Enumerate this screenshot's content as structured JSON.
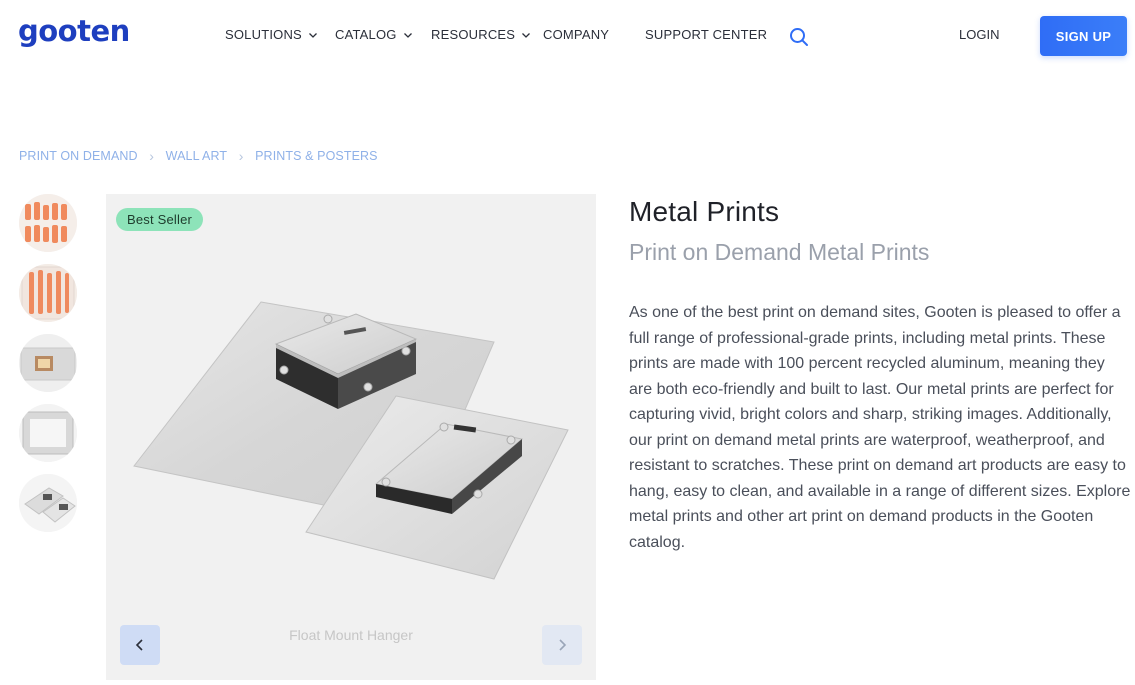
{
  "header": {
    "logo": "gooten",
    "nav": [
      {
        "label": "SOLUTIONS",
        "has_dropdown": true
      },
      {
        "label": "CATALOG",
        "has_dropdown": true
      },
      {
        "label": "RESOURCES",
        "has_dropdown": true
      },
      {
        "label": "COMPANY",
        "has_dropdown": false
      },
      {
        "label": "SUPPORT CENTER",
        "has_dropdown": false
      }
    ],
    "search_icon": "search-icon",
    "login": "LOGIN",
    "signup": "SIGN UP"
  },
  "breadcrumb": [
    "PRINT ON DEMAND",
    "WALL ART",
    "PRINTS & POSTERS"
  ],
  "gallery": {
    "badge": "Best Seller",
    "caption": "Float Mount Hanger",
    "thumbnail_count": 5
  },
  "product": {
    "title": "Metal Prints",
    "subtitle": "Print on Demand Metal Prints",
    "description": "As one of the best print on demand sites, Gooten is pleased to offer a full range of professional-grade prints, including metal prints. These prints are made with 100 percent recycled aluminum, meaning they are both eco-friendly and built to last. Our metal prints are perfect for capturing vivid, bright colors and sharp, striking images. Additionally, our print on demand metal prints are waterproof, weatherproof, and resistant to scratches. These print on demand art products are easy to hang, easy to clean, and available in a range of different sizes. Explore metal prints and other art print on demand products in the Gooten catalog."
  },
  "colors": {
    "brand": "#1e3fbf",
    "accent": "#2f6df6",
    "badge": "#8de3b9",
    "breadcrumb": "#8fb1e8"
  }
}
